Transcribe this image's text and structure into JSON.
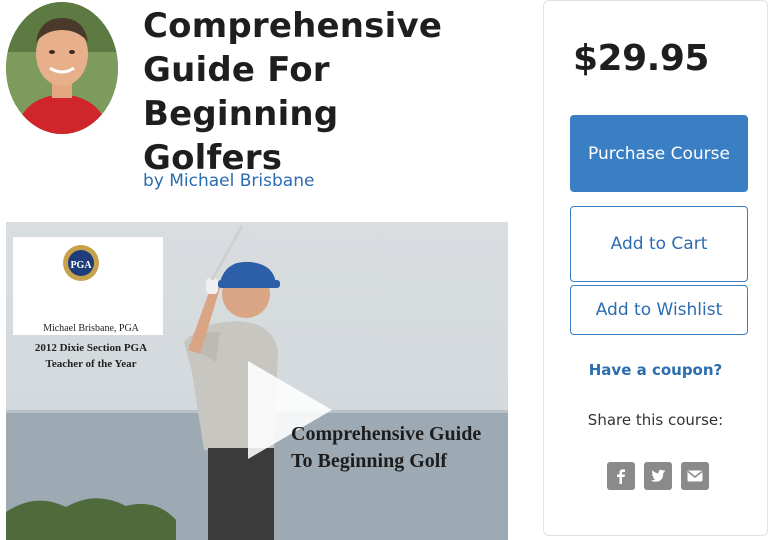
{
  "course": {
    "title": "Comprehensive Guide For Beginning Golfers",
    "byline": "by Michael Brisbane"
  },
  "video": {
    "badge_name": "Michael Brisbane, PGA",
    "badge_award_line1": "2012 Dixie Section PGA",
    "badge_award_line2": "Teacher of the Year",
    "logo_text": "PGA",
    "overlay_line1": "Comprehensive Guide",
    "overlay_line2": "To Beginning Golf"
  },
  "sidebar": {
    "price": "$29.95",
    "purchase_label": "Purchase Course",
    "cart_label": "Add to Cart",
    "wishlist_label": "Add to Wishlist",
    "coupon_label": "Have a coupon?",
    "share_label": "Share this course:",
    "social_icons": [
      "facebook-icon",
      "twitter-icon",
      "email-icon"
    ]
  },
  "colors": {
    "accent": "#3a7ec4",
    "link": "#2c6cb0",
    "social": "#8a8a8a"
  }
}
